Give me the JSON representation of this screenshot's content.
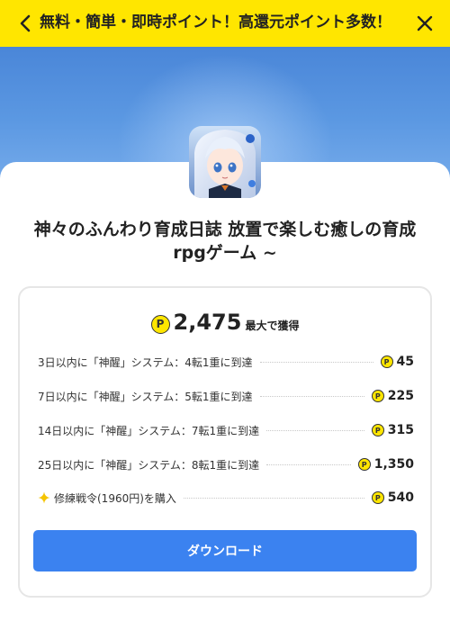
{
  "header": {
    "title": "無料・簡単・即時ポイント！高還元ポイント多数！",
    "background": "#ffe600"
  },
  "app": {
    "title": "神々のふんわり育成日誌 放置で楽しむ癒しの育成rpgゲーム ~"
  },
  "rewards": {
    "coin_symbol": "P",
    "total": "2,475",
    "total_suffix": "最大で獲得",
    "items": [
      {
        "label": "3日以内に「神醒」システム：4転1重に到達",
        "points": "45"
      },
      {
        "label": "7日以内に「神醒」システム：5転1重に到達",
        "points": "225"
      },
      {
        "label": "14日以内に「神醒」システム：7転1重に到達",
        "points": "315"
      },
      {
        "label": "25日以内に「神醒」システム：8転1重に到達",
        "points": "1,350"
      },
      {
        "label": "修練戦令(1960円)を購入",
        "points": "540",
        "icon": "sparkle-icon"
      }
    ]
  },
  "download_label": "ダウンロード",
  "colors": {
    "accent": "#3b82f0",
    "coin": "#ffe600"
  }
}
